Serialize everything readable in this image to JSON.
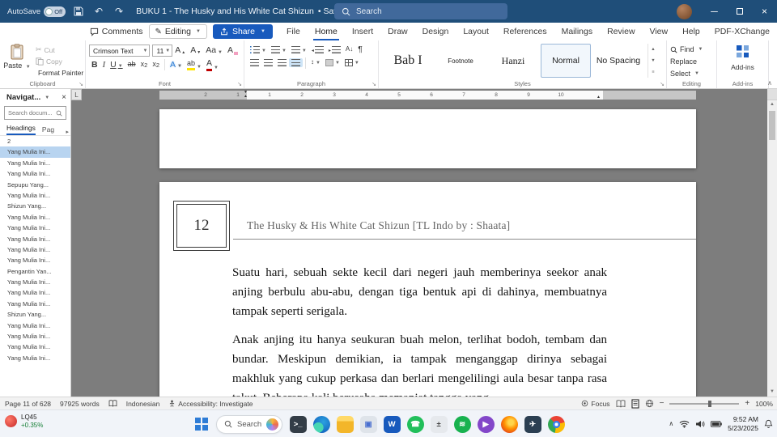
{
  "colors": {
    "titlebar": "#1f4e79",
    "accent": "#185abd",
    "doc_bg": "#7d7d7d",
    "nav_selected": "#b8d4f0",
    "stock_up": "#188038"
  },
  "titlebar": {
    "autosave_label": "AutoSave",
    "autosave_state": "Off",
    "doc_title": "BUKU 1 - The Husky and His White Cat Shizun",
    "save_state": "Saved",
    "search_placeholder": "Search"
  },
  "ribbon_tabs": {
    "tabs": [
      {
        "label": "File"
      },
      {
        "label": "Home",
        "active": true
      },
      {
        "label": "Insert"
      },
      {
        "label": "Draw"
      },
      {
        "label": "Design"
      },
      {
        "label": "Layout"
      },
      {
        "label": "References"
      },
      {
        "label": "Mailings"
      },
      {
        "label": "Review"
      },
      {
        "label": "View"
      },
      {
        "label": "Help"
      },
      {
        "label": "PDF-XChange"
      }
    ],
    "comments": "Comments",
    "editing": "Editing",
    "share": "Share"
  },
  "ribbon": {
    "clipboard": {
      "paste": "Paste",
      "cut": "Cut",
      "copy": "Copy",
      "format_painter": "Format Painter",
      "group_label": "Clipboard"
    },
    "font": {
      "family": "Crimson Text",
      "size": "11",
      "group_label": "Font"
    },
    "paragraph": {
      "group_label": "Paragraph",
      "active_alignment": "justify"
    },
    "styles": {
      "items": [
        "Bab I",
        "Footnote",
        "Hanzi",
        "Normal",
        "No Spacing"
      ],
      "selected": "Normal",
      "group_label": "Styles"
    },
    "editing": {
      "find": "Find",
      "replace": "Replace",
      "select": "Select",
      "group_label": "Editing"
    },
    "addins": {
      "label": "Add-ins",
      "group_label": "Add-ins"
    }
  },
  "navigation": {
    "title": "Navigat...",
    "search_placeholder": "Search docum...",
    "tab_headings": "Headings",
    "tab_pages": "Pag",
    "items": [
      {
        "label": "2"
      },
      {
        "label": "Yang Mulia Ini...",
        "selected": true
      },
      {
        "label": "Yang Mulia Ini..."
      },
      {
        "label": "Yang Mulia Ini..."
      },
      {
        "label": "Sepupu Yang..."
      },
      {
        "label": "Yang Mulia Ini..."
      },
      {
        "label": "Shizun Yang..."
      },
      {
        "label": "Yang Mulia Ini..."
      },
      {
        "label": "Yang Mulia Ini..."
      },
      {
        "label": "Yang Mulia Ini..."
      },
      {
        "label": "Yang Mulia Ini..."
      },
      {
        "label": "Yang Mulia Ini..."
      },
      {
        "label": "Pengantin Yan..."
      },
      {
        "label": "Yang Mulia Ini..."
      },
      {
        "label": "Yang Mulia Ini..."
      },
      {
        "label": "Yang Mulia Ini..."
      },
      {
        "label": "Shizun Yang..."
      },
      {
        "label": "Yang Mulia Ini..."
      },
      {
        "label": "Yang Mulia Ini..."
      },
      {
        "label": "Yang Mulia Ini..."
      },
      {
        "label": "Yang Mulia Ini..."
      }
    ]
  },
  "ruler": {
    "margin_numbers": [
      "2",
      "1"
    ],
    "numbers": [
      "1",
      "2",
      "3",
      "4",
      "5",
      "6",
      "7",
      "8",
      "9",
      "10"
    ]
  },
  "document": {
    "chapter_number": "12",
    "chapter_title": "The Husky & His White Cat Shizun [TL Indo by : Shaata]",
    "paragraphs": [
      "Suatu hari, sebuah sekte kecil dari negeri jauh memberinya seekor anak anjing berbulu abu-abu, dengan tiga bentuk api di dahinya, membuatnya tampak seperti serigala.",
      "Anak anjing itu hanya seukuran buah melon, terlihat bodoh, tembam dan bundar. Meskipun demikian, ia tampak menganggap dirinya sebagai makhluk yang cukup perkasa dan berlari mengelilingi aula besar tanpa rasa takut. Beberapa kali berusaha memanjat tangga yang"
    ]
  },
  "statusbar": {
    "page_info": "Page 11 of 628",
    "word_count": "97925 words",
    "language": "Indonesian",
    "accessibility": "Accessibility: Investigate",
    "focus": "Focus",
    "zoom_level": "100%"
  },
  "taskbar": {
    "search_placeholder": "Search",
    "stock_ticker": "LQ45",
    "stock_change": "+0.35%",
    "time": "9:52 AM",
    "date": "5/23/2025",
    "apps": [
      {
        "name": "terminal",
        "color": "#333d47",
        "glyph": ">_"
      },
      {
        "name": "edge",
        "color": "#1269c9",
        "glyph": "",
        "round": true
      },
      {
        "name": "file-explorer",
        "color": "#f5b82d",
        "glyph": ""
      },
      {
        "name": "photos",
        "color": "#dfe4ea",
        "glyph": "▣",
        "fg": "#4a6fd0"
      },
      {
        "name": "word",
        "color": "#185abd",
        "glyph": "W"
      },
      {
        "name": "whatsapp",
        "color": "#22bf5b",
        "glyph": "☎",
        "round": true
      },
      {
        "name": "calculator",
        "color": "#e6e9ed",
        "glyph": "±",
        "fg": "#444444"
      },
      {
        "name": "spotify",
        "color": "#18b24f",
        "glyph": "≋",
        "round": true
      },
      {
        "name": "media-player",
        "color": "#8347c9",
        "glyph": "▶",
        "round": true
      },
      {
        "name": "firefox",
        "color": "#ff8a1e",
        "glyph": "",
        "round": true
      },
      {
        "name": "telegram",
        "color": "#2b3f52",
        "glyph": "✈"
      },
      {
        "name": "chrome",
        "color": "#4285f4",
        "glyph": "",
        "round": true
      }
    ]
  }
}
